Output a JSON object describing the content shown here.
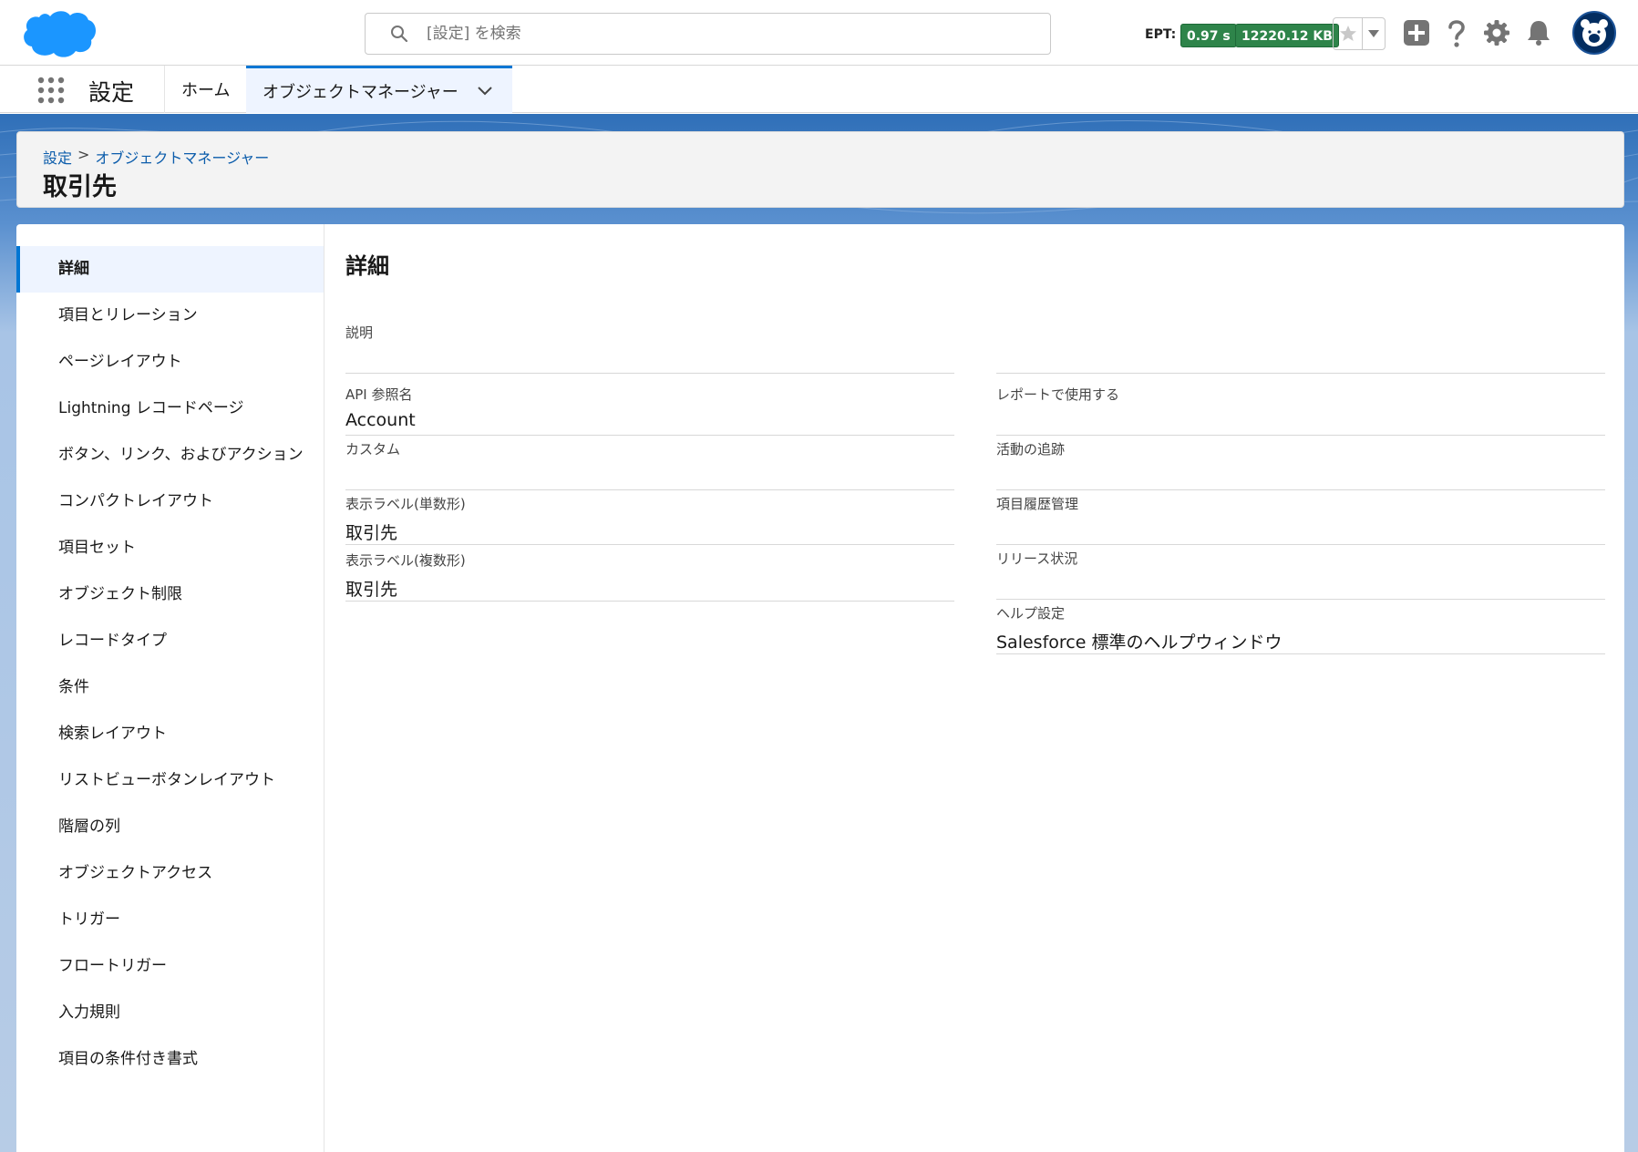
{
  "header": {
    "search": {
      "placeholder": "[設定] を検索"
    },
    "ept": {
      "label": "EPT:",
      "time": "0.97 s",
      "size": "12220.12 KB"
    },
    "colors": {
      "brand": "#1b96ff",
      "badge": "#2e844a",
      "accent": "#0176d3"
    },
    "icons": [
      "salesforce-logo",
      "search-icon",
      "star-icon",
      "chevron-down-icon",
      "add-icon",
      "help-icon",
      "gear-icon",
      "bell-icon",
      "avatar"
    ]
  },
  "nav": {
    "app_name": "設定",
    "tabs": [
      {
        "label": "ホーム"
      },
      {
        "label": "オブジェクトマネージャー",
        "active": true
      }
    ]
  },
  "page_header": {
    "breadcrumb": [
      "設定",
      "オブジェクトマネージャー"
    ],
    "separator": ">",
    "title": "取引先"
  },
  "sidebar": {
    "items": [
      {
        "label": "詳細",
        "active": true
      },
      {
        "label": "項目とリレーション"
      },
      {
        "label": "ページレイアウト"
      },
      {
        "label": "Lightning レコードページ"
      },
      {
        "label": "ボタン、リンク、およびアクション"
      },
      {
        "label": "コンパクトレイアウト"
      },
      {
        "label": "項目セット"
      },
      {
        "label": "オブジェクト制限"
      },
      {
        "label": "レコードタイプ"
      },
      {
        "label": "条件"
      },
      {
        "label": "検索レイアウト"
      },
      {
        "label": "リストビューボタンレイアウト"
      },
      {
        "label": "階層の列"
      },
      {
        "label": "オブジェクトアクセス"
      },
      {
        "label": "トリガー"
      },
      {
        "label": "フロートリガー"
      },
      {
        "label": "入力規則"
      },
      {
        "label": "項目の条件付き書式"
      }
    ]
  },
  "detail": {
    "title": "詳細",
    "description": {
      "label": "説明",
      "value": ""
    },
    "left": [
      {
        "label": "API 参照名",
        "value": "Account"
      },
      {
        "label": "カスタム",
        "value": ""
      },
      {
        "label": "表示ラベル(単数形)",
        "value": "取引先"
      },
      {
        "label": "表示ラベル(複数形)",
        "value": "取引先"
      }
    ],
    "right": [
      {
        "label": "レポートで使用する",
        "value": ""
      },
      {
        "label": "活動の追跡",
        "value": ""
      },
      {
        "label": "項目履歴管理",
        "value": ""
      },
      {
        "label": "リリース状況",
        "value": ""
      },
      {
        "label": "ヘルプ設定",
        "value": "Salesforce 標準のヘルプウィンドウ"
      }
    ]
  }
}
